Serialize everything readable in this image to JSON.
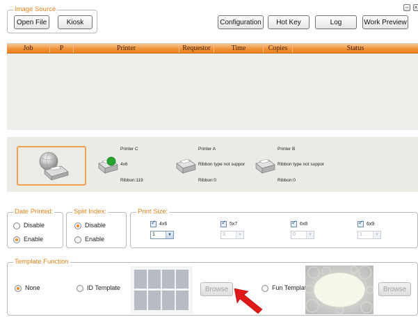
{
  "image_source": {
    "legend": "Image Source",
    "open_file": "Open File",
    "kiosk": "Kiosk"
  },
  "toolbar": {
    "configuration": "Configuration",
    "hot_key": "Hot Key",
    "log": "Log",
    "work_preview": "Work Preview"
  },
  "window_controls": {
    "minimize": "–",
    "close": "×"
  },
  "job_table": {
    "columns": [
      "Job",
      "P",
      "Printer",
      "Requestor",
      "Time",
      "Copies",
      "Status"
    ],
    "rows": []
  },
  "printers": [
    {
      "name": "Printer C",
      "media": "4x6",
      "ribbon": "Ribbon:119",
      "status": "online"
    },
    {
      "name": "Printer A",
      "media": "Ribbon type not suppor",
      "ribbon": "Ribbon:0",
      "status": "idle"
    },
    {
      "name": "Printer B",
      "media": "Ribbon type not suppor",
      "ribbon": "Ribbon:0",
      "status": "idle"
    }
  ],
  "date_printed": {
    "legend": "Date Printed:",
    "options": [
      "Disable",
      "Enable"
    ],
    "selected": "Enable"
  },
  "split_index": {
    "legend": "Split Index:",
    "options": [
      "Disable",
      "Enable"
    ],
    "selected": "Disable"
  },
  "print_size": {
    "legend": "Print Size:",
    "items": [
      {
        "label": "4x6",
        "checked": true,
        "value": "1",
        "enabled": true
      },
      {
        "label": "5x7",
        "checked": true,
        "value": "3",
        "enabled": false
      },
      {
        "label": "6x8",
        "checked": true,
        "value": "0",
        "enabled": false
      },
      {
        "label": "6x9",
        "checked": true,
        "value": "1",
        "enabled": false
      }
    ]
  },
  "template_function": {
    "legend": "Template Function",
    "none": "None",
    "id_template": "ID Template",
    "browse_1": "Browse",
    "fun_template": "Fun Template",
    "browse_2": "Browse",
    "selected": "None"
  },
  "colors": {
    "accent": "#e8821c",
    "legend_text": "#e8821a",
    "online_indicator": "#1f9a2e",
    "arrow": "#e01818"
  }
}
